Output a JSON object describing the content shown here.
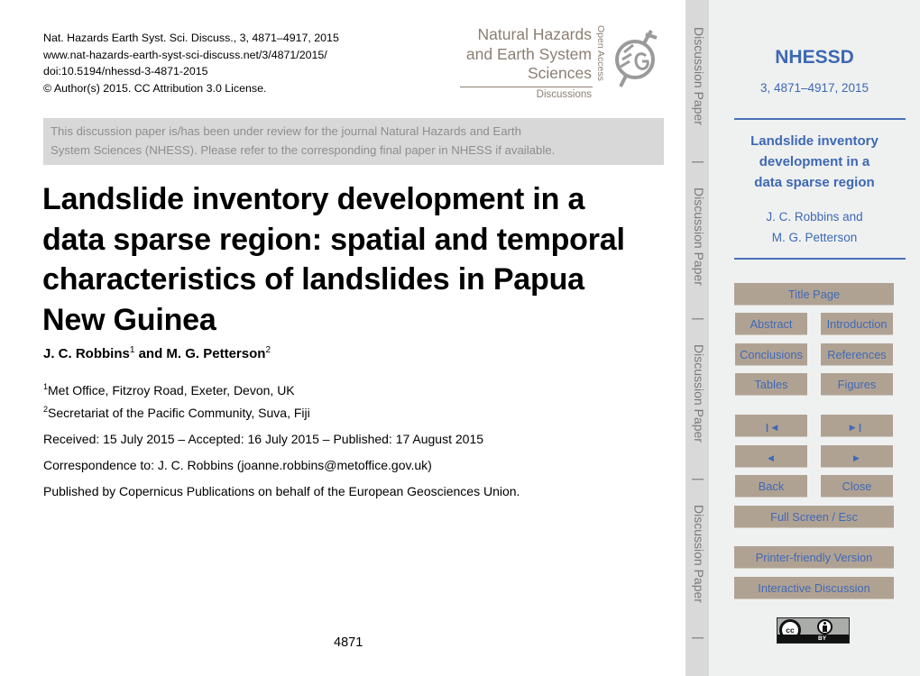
{
  "citation": {
    "line1": "Nat. Hazards Earth Syst. Sci. Discuss., 3, 4871–4917, 2015",
    "line2": "www.nat-hazards-earth-syst-sci-discuss.net/3/4871/2015/",
    "line3": "doi:10.5194/nhessd-3-4871-2015",
    "line4": "© Author(s) 2015. CC Attribution 3.0 License."
  },
  "journal_logo": {
    "name_line1": "Natural Hazards",
    "name_line2": "and Earth System",
    "name_line3": "Sciences",
    "subtitle": "Discussions",
    "open_access": "Open Access",
    "icon": "egu-globe-icon"
  },
  "review_banner": {
    "line1": "This discussion paper is/has been under review for the journal Natural Hazards and Earth",
    "line2": "System Sciences (NHESS). Please refer to the corresponding final paper in NHESS if available."
  },
  "paper": {
    "title_line1": "Landslide inventory development in a",
    "title_line2": "data sparse region: spatial and temporal",
    "title_line3": "characteristics of landslides in Papua",
    "title_line4": "New Guinea",
    "author1": "J. C. Robbins",
    "author1_sup": "1",
    "author_and": " and ",
    "author2": "M. G. Petterson",
    "author2_sup": "2",
    "affil1_sup": "1",
    "affil1": "Met Office, Fitzroy Road, Exeter, Devon, UK",
    "affil2_sup": "2",
    "affil2": "Secretariat of the Pacific Community, Suva, Fiji",
    "received": "Received: 15 July 2015 – Accepted: 16 July 2015 – Published: 17 August 2015",
    "correspondence": "Correspondence to: J. C. Robbins (joanne.robbins@metoffice.gov.uk)",
    "publisher": "Published by Copernicus Publications on behalf of the European Geosciences Union.",
    "page_number": "4871"
  },
  "discussion_strip": {
    "label": "Discussion Paper",
    "separator": "|"
  },
  "sidebar": {
    "journal_abbr": "NHESSD",
    "volume": "3, 4871–4917, 2015",
    "short_title_line1": "Landslide inventory",
    "short_title_line2": "development in a",
    "short_title_line3": "data sparse region",
    "authors_line1": "J. C. Robbins and",
    "authors_line2": "M. G. Petterson",
    "buttons": {
      "title_page": "Title Page",
      "abstract": "Abstract",
      "introduction": "Introduction",
      "conclusions": "Conclusions",
      "references": "References",
      "tables": "Tables",
      "figures": "Figures",
      "first": "◀",
      "last": "▶",
      "prev": "◀",
      "next": "▶",
      "back": "Back",
      "close": "Close",
      "full_screen": "Full Screen / Esc",
      "printer_friendly": "Printer-friendly Version",
      "interactive_discussion": "Interactive Discussion"
    },
    "license_badge": {
      "cc": "cc",
      "by": "BY"
    }
  },
  "colors": {
    "accent_blue": "#3e68b3",
    "button_bg": "#b0a293",
    "logo_taupe": "#8b7f72",
    "sidebar_bg": "#eff1f1",
    "banner_bg": "#d8d8d8"
  }
}
